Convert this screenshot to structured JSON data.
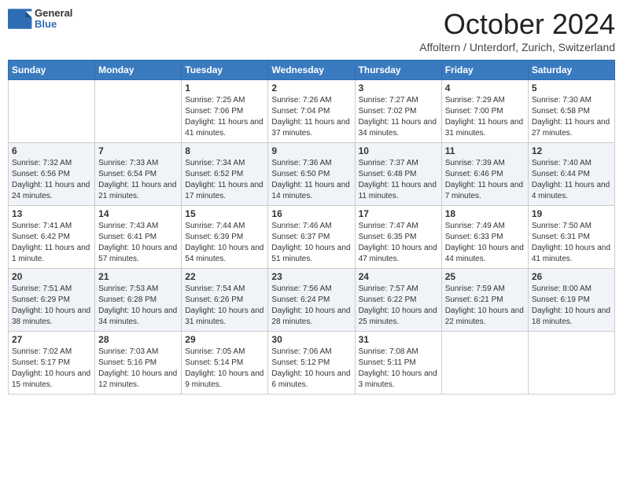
{
  "header": {
    "logo_general": "General",
    "logo_blue": "Blue",
    "month_title": "October 2024",
    "subtitle": "Affoltern / Unterdorf, Zurich, Switzerland"
  },
  "days_of_week": [
    "Sunday",
    "Monday",
    "Tuesday",
    "Wednesday",
    "Thursday",
    "Friday",
    "Saturday"
  ],
  "weeks": [
    [
      null,
      null,
      {
        "day": 1,
        "sunrise": "Sunrise: 7:25 AM",
        "sunset": "Sunset: 7:06 PM",
        "daylight": "Daylight: 11 hours and 41 minutes."
      },
      {
        "day": 2,
        "sunrise": "Sunrise: 7:26 AM",
        "sunset": "Sunset: 7:04 PM",
        "daylight": "Daylight: 11 hours and 37 minutes."
      },
      {
        "day": 3,
        "sunrise": "Sunrise: 7:27 AM",
        "sunset": "Sunset: 7:02 PM",
        "daylight": "Daylight: 11 hours and 34 minutes."
      },
      {
        "day": 4,
        "sunrise": "Sunrise: 7:29 AM",
        "sunset": "Sunset: 7:00 PM",
        "daylight": "Daylight: 11 hours and 31 minutes."
      },
      {
        "day": 5,
        "sunrise": "Sunrise: 7:30 AM",
        "sunset": "Sunset: 6:58 PM",
        "daylight": "Daylight: 11 hours and 27 minutes."
      }
    ],
    [
      {
        "day": 6,
        "sunrise": "Sunrise: 7:32 AM",
        "sunset": "Sunset: 6:56 PM",
        "daylight": "Daylight: 11 hours and 24 minutes."
      },
      {
        "day": 7,
        "sunrise": "Sunrise: 7:33 AM",
        "sunset": "Sunset: 6:54 PM",
        "daylight": "Daylight: 11 hours and 21 minutes."
      },
      {
        "day": 8,
        "sunrise": "Sunrise: 7:34 AM",
        "sunset": "Sunset: 6:52 PM",
        "daylight": "Daylight: 11 hours and 17 minutes."
      },
      {
        "day": 9,
        "sunrise": "Sunrise: 7:36 AM",
        "sunset": "Sunset: 6:50 PM",
        "daylight": "Daylight: 11 hours and 14 minutes."
      },
      {
        "day": 10,
        "sunrise": "Sunrise: 7:37 AM",
        "sunset": "Sunset: 6:48 PM",
        "daylight": "Daylight: 11 hours and 11 minutes."
      },
      {
        "day": 11,
        "sunrise": "Sunrise: 7:39 AM",
        "sunset": "Sunset: 6:46 PM",
        "daylight": "Daylight: 11 hours and 7 minutes."
      },
      {
        "day": 12,
        "sunrise": "Sunrise: 7:40 AM",
        "sunset": "Sunset: 6:44 PM",
        "daylight": "Daylight: 11 hours and 4 minutes."
      }
    ],
    [
      {
        "day": 13,
        "sunrise": "Sunrise: 7:41 AM",
        "sunset": "Sunset: 6:42 PM",
        "daylight": "Daylight: 11 hours and 1 minute."
      },
      {
        "day": 14,
        "sunrise": "Sunrise: 7:43 AM",
        "sunset": "Sunset: 6:41 PM",
        "daylight": "Daylight: 10 hours and 57 minutes."
      },
      {
        "day": 15,
        "sunrise": "Sunrise: 7:44 AM",
        "sunset": "Sunset: 6:39 PM",
        "daylight": "Daylight: 10 hours and 54 minutes."
      },
      {
        "day": 16,
        "sunrise": "Sunrise: 7:46 AM",
        "sunset": "Sunset: 6:37 PM",
        "daylight": "Daylight: 10 hours and 51 minutes."
      },
      {
        "day": 17,
        "sunrise": "Sunrise: 7:47 AM",
        "sunset": "Sunset: 6:35 PM",
        "daylight": "Daylight: 10 hours and 47 minutes."
      },
      {
        "day": 18,
        "sunrise": "Sunrise: 7:49 AM",
        "sunset": "Sunset: 6:33 PM",
        "daylight": "Daylight: 10 hours and 44 minutes."
      },
      {
        "day": 19,
        "sunrise": "Sunrise: 7:50 AM",
        "sunset": "Sunset: 6:31 PM",
        "daylight": "Daylight: 10 hours and 41 minutes."
      }
    ],
    [
      {
        "day": 20,
        "sunrise": "Sunrise: 7:51 AM",
        "sunset": "Sunset: 6:29 PM",
        "daylight": "Daylight: 10 hours and 38 minutes."
      },
      {
        "day": 21,
        "sunrise": "Sunrise: 7:53 AM",
        "sunset": "Sunset: 6:28 PM",
        "daylight": "Daylight: 10 hours and 34 minutes."
      },
      {
        "day": 22,
        "sunrise": "Sunrise: 7:54 AM",
        "sunset": "Sunset: 6:26 PM",
        "daylight": "Daylight: 10 hours and 31 minutes."
      },
      {
        "day": 23,
        "sunrise": "Sunrise: 7:56 AM",
        "sunset": "Sunset: 6:24 PM",
        "daylight": "Daylight: 10 hours and 28 minutes."
      },
      {
        "day": 24,
        "sunrise": "Sunrise: 7:57 AM",
        "sunset": "Sunset: 6:22 PM",
        "daylight": "Daylight: 10 hours and 25 minutes."
      },
      {
        "day": 25,
        "sunrise": "Sunrise: 7:59 AM",
        "sunset": "Sunset: 6:21 PM",
        "daylight": "Daylight: 10 hours and 22 minutes."
      },
      {
        "day": 26,
        "sunrise": "Sunrise: 8:00 AM",
        "sunset": "Sunset: 6:19 PM",
        "daylight": "Daylight: 10 hours and 18 minutes."
      }
    ],
    [
      {
        "day": 27,
        "sunrise": "Sunrise: 7:02 AM",
        "sunset": "Sunset: 5:17 PM",
        "daylight": "Daylight: 10 hours and 15 minutes."
      },
      {
        "day": 28,
        "sunrise": "Sunrise: 7:03 AM",
        "sunset": "Sunset: 5:16 PM",
        "daylight": "Daylight: 10 hours and 12 minutes."
      },
      {
        "day": 29,
        "sunrise": "Sunrise: 7:05 AM",
        "sunset": "Sunset: 5:14 PM",
        "daylight": "Daylight: 10 hours and 9 minutes."
      },
      {
        "day": 30,
        "sunrise": "Sunrise: 7:06 AM",
        "sunset": "Sunset: 5:12 PM",
        "daylight": "Daylight: 10 hours and 6 minutes."
      },
      {
        "day": 31,
        "sunrise": "Sunrise: 7:08 AM",
        "sunset": "Sunset: 5:11 PM",
        "daylight": "Daylight: 10 hours and 3 minutes."
      },
      null,
      null
    ]
  ]
}
